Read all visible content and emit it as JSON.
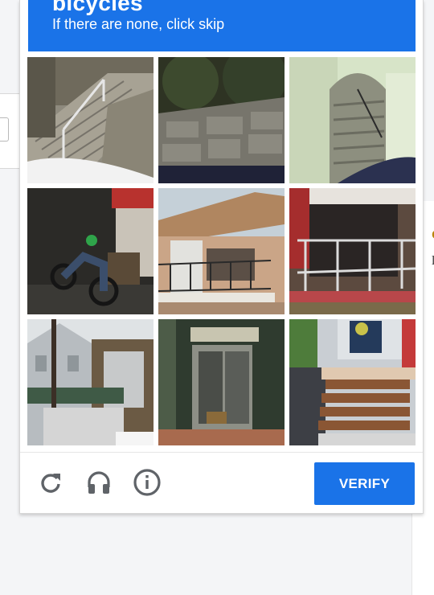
{
  "challenge": {
    "title": "bicycles",
    "instruction": "If there are none, click skip",
    "header_color": "#1a73e8"
  },
  "tiles": [
    {
      "name": "tile-outdoor-concrete-stairs"
    },
    {
      "name": "tile-stone-wall"
    },
    {
      "name": "tile-green-archway-stairs"
    },
    {
      "name": "tile-motorcycle-in-garage"
    },
    {
      "name": "tile-building-balcony"
    },
    {
      "name": "tile-porch-railing"
    },
    {
      "name": "tile-street-houses"
    },
    {
      "name": "tile-shop-entrance"
    },
    {
      "name": "tile-wooden-porch-stairs"
    }
  ],
  "controls": {
    "reload_icon": "reload-icon",
    "audio_icon": "headphones-icon",
    "info_icon": "info-icon",
    "verify_label": "VERIFY"
  }
}
